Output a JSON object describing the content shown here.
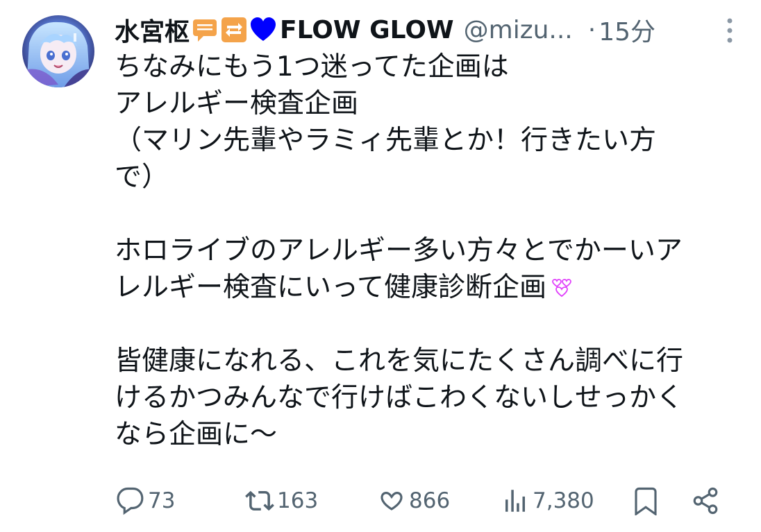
{
  "user": {
    "display_name": "水宮枢",
    "flow_name": "FLOW GLOW",
    "handle": "@mizu...",
    "separator": "·",
    "time": "15分",
    "emojis": [
      "speech-bubble-emoji",
      "repeat-emoji",
      "blue-heart-emoji"
    ]
  },
  "tweet": {
    "lines": [
      "ちなみにもう1つ迷ってた企画は",
      "アレルギー検査企画",
      "（マリン先輩やラミィ先輩とか！行きたい方",
      "で）",
      "",
      "ホロライブのアレルギー多い方々とでかーいア",
      "レルギー検査にいって健康診断企画",
      "",
      "皆健康になれる、これを気にたくさん調べに行",
      "けるかつみんなで行けばこわくないしせっかく",
      "なら企画に〜"
    ],
    "inline_emoji": "pink-hearts-emoji"
  },
  "actions": {
    "replies": "73",
    "reposts": "163",
    "likes": "866",
    "views": "7,380"
  },
  "colors": {
    "text": "#0f1419",
    "secondary": "#536471",
    "blue_heart": "#0000ff",
    "pink": "#e040fb"
  }
}
